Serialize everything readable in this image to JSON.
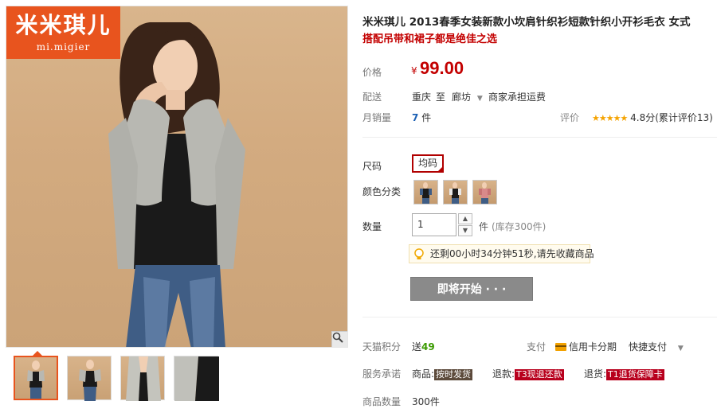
{
  "brand": {
    "name_cn": "米米琪儿",
    "name_en": "mi.migier"
  },
  "product": {
    "title": "米米琪儿 2013春季女装新款小坎肩针织衫短款针织小开衫毛衣 女式",
    "subtitle": "搭配吊带和裙子都是绝佳之选"
  },
  "price": {
    "label": "价格",
    "currency": "¥",
    "value": "99.00"
  },
  "shipping": {
    "label": "配送",
    "from": "重庆",
    "to_word": "至",
    "to": "廊坊",
    "fee_text": "商家承担运费"
  },
  "sales": {
    "label": "月销量",
    "count": "7",
    "unit": "件",
    "rating_label": "评价",
    "stars": "★★★★★",
    "rating_text": "4.8分(累计评价13)"
  },
  "options": {
    "size_label": "尺码",
    "size_value": "均码",
    "color_label": "颜色分类",
    "qty_label": "数量",
    "qty_value": "1",
    "qty_unit": "件",
    "stock_text": "(库存300件)"
  },
  "countdown": {
    "text": "还剩00小时34分钟51秒,请先收藏商品"
  },
  "buy_button": {
    "label": "即将开始 · · ·"
  },
  "service": {
    "points_label": "天猫积分",
    "points_prefix": "送",
    "points_value": "49",
    "pay_label": "支付",
    "credit_card": "信用卡分期",
    "quick_pay": "快捷支付",
    "promise_label": "服务承诺",
    "promise1_prefix": "商品:",
    "promise1_tag": "按时发货",
    "promise2_prefix": "退款:",
    "promise2_tag": "T3现退还款",
    "promise3_prefix": "退货:",
    "promise3_tag": "T1退货保障卡",
    "stock_label": "商品数量",
    "stock_value": "300件"
  },
  "colors": {
    "accent": "#c30000",
    "brand": "#e8541e",
    "button_gray": "#8a8a8a"
  }
}
